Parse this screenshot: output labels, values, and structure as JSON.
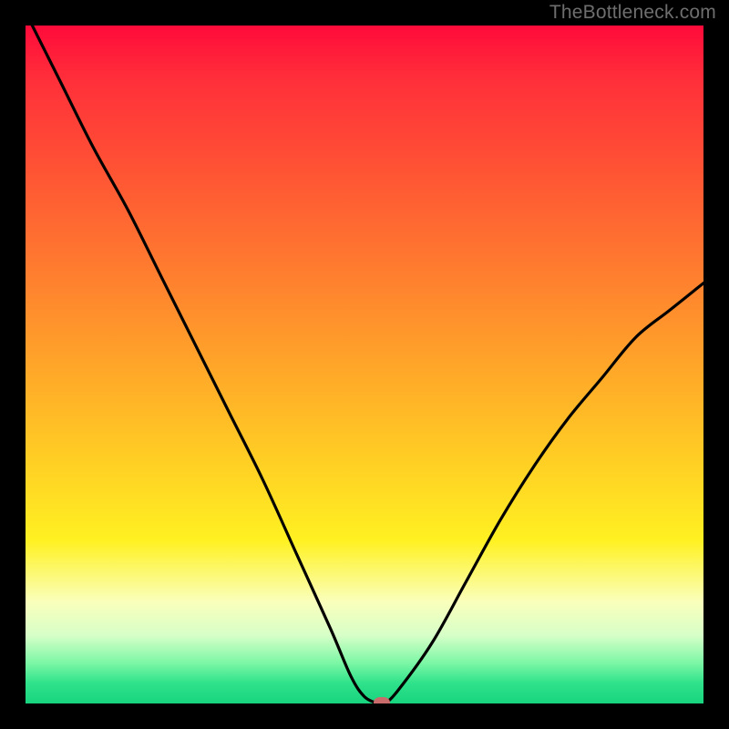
{
  "watermark": "TheBottleneck.com",
  "chart_data": {
    "type": "line",
    "title": "",
    "xlabel": "",
    "ylabel": "",
    "xlim": [
      0,
      100
    ],
    "ylim": [
      0,
      100
    ],
    "series": [
      {
        "name": "bottleneck-curve",
        "x": [
          1,
          5,
          10,
          15,
          20,
          25,
          30,
          35,
          40,
          45,
          48,
          50,
          52,
          53,
          55,
          60,
          65,
          70,
          75,
          80,
          85,
          90,
          95,
          100
        ],
        "y": [
          100,
          92,
          82,
          73,
          63,
          53,
          43,
          33,
          22,
          11,
          4,
          1,
          0,
          0,
          2,
          9,
          18,
          27,
          35,
          42,
          48,
          54,
          58,
          62
        ]
      }
    ],
    "marker": {
      "x": 52.5,
      "y": 0,
      "label": "optimal-point"
    },
    "gradient_stops": [
      {
        "pos": 0,
        "color": "#ff0a3a"
      },
      {
        "pos": 22,
        "color": "#ff5534"
      },
      {
        "pos": 50,
        "color": "#ffa529"
      },
      {
        "pos": 76,
        "color": "#fff122"
      },
      {
        "pos": 90,
        "color": "#d6ffc8"
      },
      {
        "pos": 100,
        "color": "#18d47e"
      }
    ]
  }
}
